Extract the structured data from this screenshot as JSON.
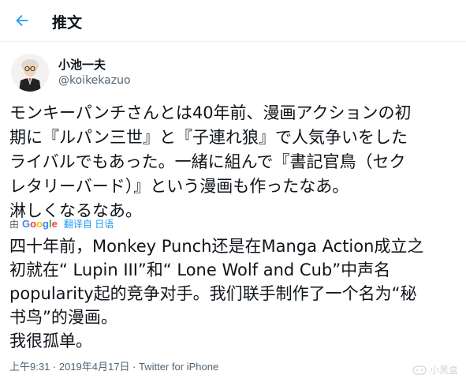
{
  "header": {
    "title": "推文"
  },
  "author": {
    "name": "小池一夫",
    "handle": "@koikekazuo"
  },
  "tweet": {
    "text": "モンキーパンチさんとは40年前、漫画アクションの初\n期に『ルパン三世』と『子連れ狼』で人気争いをした\nライバルでもあった。一緒に組んで『書記官鳥（セク\nレタリーバード）』という漫画も作ったなあ。\n淋しくなるなあ。"
  },
  "translation": {
    "by": "由",
    "provider": "Google",
    "link_label": "翻译自 日语",
    "text": "四十年前，Monkey Punch还是在Manga Action成立之\n初就在“ Lupin III”和“ Lone Wolf and Cub”中声名\npopularity起的竞争对手。我们联手制作了一个名为“秘\n书鸟”的漫画。\n我很孤单。"
  },
  "meta": {
    "timestamp": "上午9:31 · 2019年4月17日 · ",
    "source": "Twitter for iPhone"
  },
  "watermark": {
    "text": "小黑盒"
  },
  "colors": {
    "accent": "#1d9bf0",
    "text": "#0f1419",
    "secondary": "#536471"
  }
}
